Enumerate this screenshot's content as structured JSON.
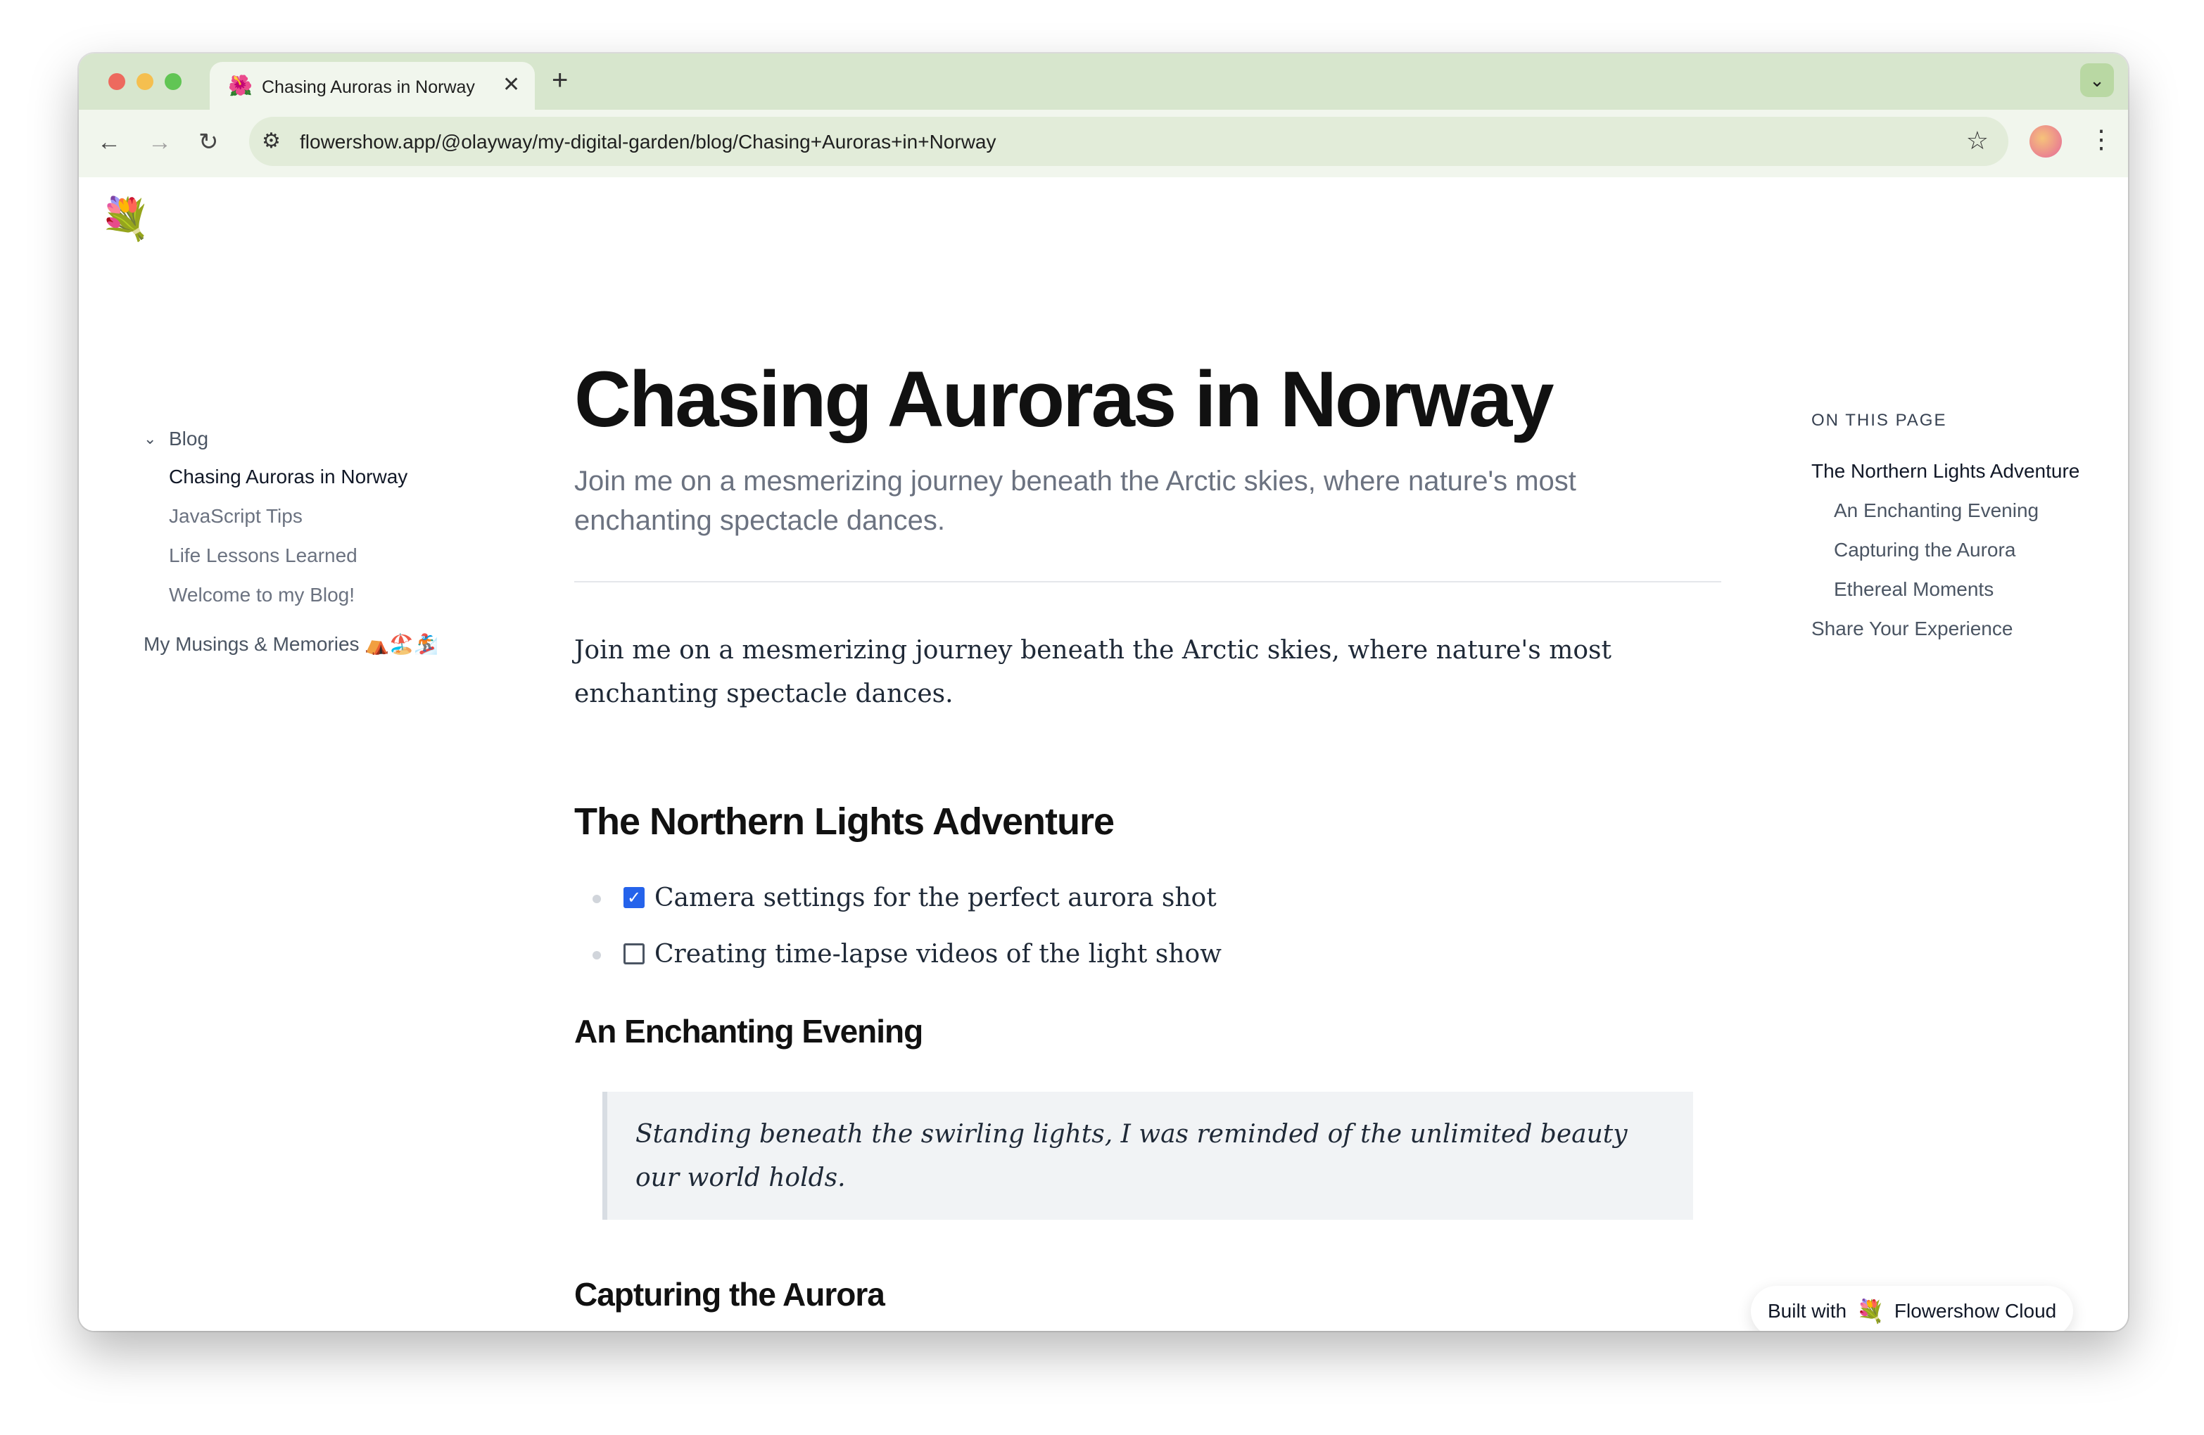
{
  "browser": {
    "tab_title": "Chasing Auroras in Norway",
    "tab_favicon": "🌺",
    "url": "flowershow.app/@olayway/my-digital-garden/blog/Chasing+Auroras+in+Norway",
    "accent_color": "#d7e6cd"
  },
  "site": {
    "logo": "💐"
  },
  "sidebar": {
    "folder_label": "Blog",
    "items": [
      {
        "label": "Chasing Auroras in Norway"
      },
      {
        "label": "JavaScript Tips"
      },
      {
        "label": "Life Lessons Learned"
      },
      {
        "label": "Welcome to my Blog!"
      }
    ],
    "musings_label": "My Musings & Memories ⛺🏖️🏂"
  },
  "article": {
    "title": "Chasing Auroras in Norway",
    "subtitle": "Join me on a mesmerizing journey beneath the Arctic skies, where nature's most enchanting spectacle dances.",
    "lead": "Join me on a mesmerizing journey beneath the Arctic skies, where nature's most enchanting spectacle dances.",
    "section1_heading": "The Northern Lights Adventure",
    "tasks": [
      {
        "label": "Camera settings for the perfect aurora shot",
        "checked": true
      },
      {
        "label": "Creating time-lapse videos of the light show",
        "checked": false
      }
    ],
    "section2_heading": "An Enchanting Evening",
    "quote": "Standing beneath the swirling lights, I was reminded of the unlimited beauty our world holds.",
    "section3_heading": "Capturing the Aurora"
  },
  "toc": {
    "heading": "ON THIS PAGE",
    "items": [
      {
        "label": "The Northern Lights Adventure"
      },
      {
        "label": "An Enchanting Evening"
      },
      {
        "label": "Capturing the Aurora"
      },
      {
        "label": "Ethereal Moments"
      },
      {
        "label": "Share Your Experience"
      }
    ]
  },
  "badge": {
    "prefix": "Built with",
    "icon": "💐",
    "name": "Flowershow Cloud"
  },
  "icons": {
    "back": "back-arrow-icon",
    "forward": "forward-arrow-icon",
    "reload": "reload-icon",
    "site_info": "tune-icon",
    "bookmark": "star-icon",
    "menu": "kebab-menu-icon",
    "chevron": "chevron-down-icon",
    "close": "close-icon",
    "new_tab": "plus-icon"
  }
}
